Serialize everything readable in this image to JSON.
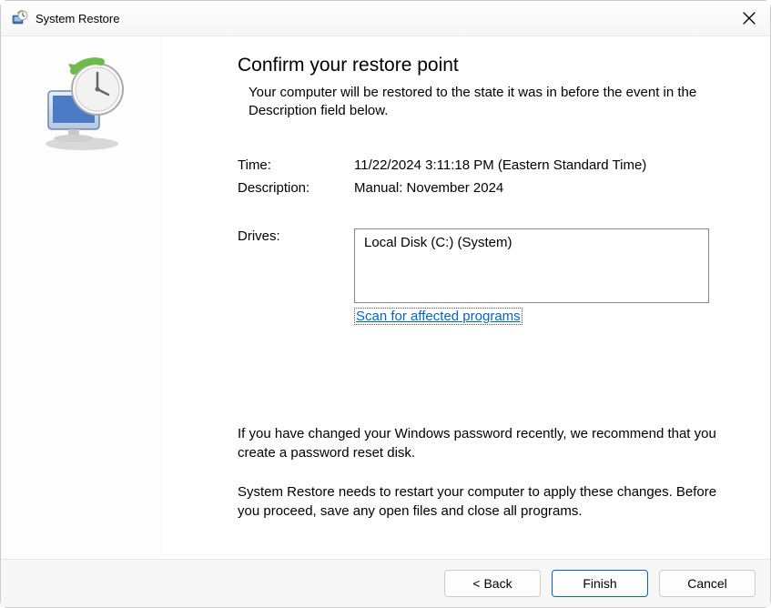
{
  "window": {
    "title": "System Restore"
  },
  "main": {
    "heading": "Confirm your restore point",
    "subheading": "Your computer will be restored to the state it was in before the event in the Description field below.",
    "time_label": "Time:",
    "time_value": "11/22/2024 3:11:18 PM (Eastern Standard Time)",
    "description_label": "Description:",
    "description_value": "Manual: November 2024",
    "drives_label": "Drives:",
    "drives_value": "Local Disk (C:) (System)",
    "scan_link": "Scan for affected programs",
    "note1": "If you have changed your Windows password recently, we recommend that you create a password reset disk.",
    "note2": "System Restore needs to restart your computer to apply these changes. Before you proceed, save any open files and close all programs."
  },
  "footer": {
    "back": "< Back",
    "finish": "Finish",
    "cancel": "Cancel"
  }
}
